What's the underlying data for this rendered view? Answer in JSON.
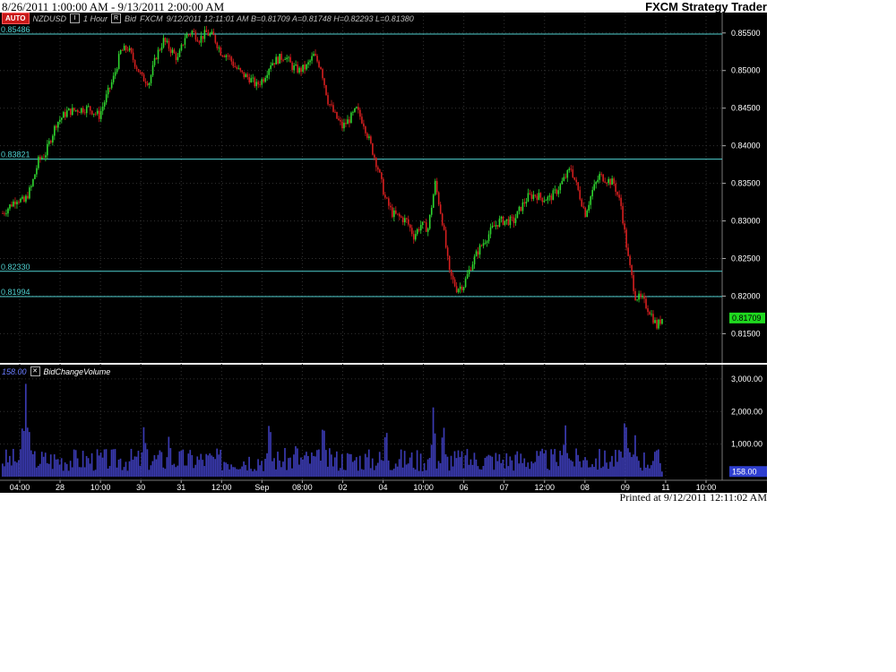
{
  "header": {
    "range": "8/26/2011 1:00:00 AM - 9/13/2011 2:00:00 AM",
    "app": "FXCM Strategy Trader"
  },
  "footer": {
    "printed": "Printed at 9/12/2011 12:11:02 AM"
  },
  "toolbar": {
    "auto_label": "AUTO",
    "symbol": "NZDUSD",
    "timeframe": "1 Hour",
    "price_type": "Bid",
    "broker": "FXCM",
    "quote": "9/12/2011  12:11:01 AM  B=0.81709  A=0.81748  H=0.82293  L=0.81380"
  },
  "volume_panel": {
    "current_label": "158.00",
    "indicator_name": "BidChangeVolume"
  },
  "colors": {
    "background": "#000000",
    "bull": "#2fd62f",
    "bear": "#d61f1f",
    "level_lines": "#4fd0d0",
    "volume_bars": "#3a3ab0",
    "price_tag": "#1fd81f",
    "volume_tag": "#2f3fd0"
  },
  "chart_data": [
    {
      "type": "candlestick",
      "series": [
        {
          "name": "NZDUSD"
        }
      ],
      "ylim": [
        0.811,
        0.857
      ],
      "y_ticks": [
        0.855,
        0.85,
        0.845,
        0.84,
        0.835,
        0.83,
        0.825,
        0.82,
        0.815
      ],
      "y_tick_labels": [
        "0.85500",
        "0.85000",
        "0.84500",
        "0.84000",
        "0.83500",
        "0.83000",
        "0.82500",
        "0.82000",
        "0.81500"
      ],
      "x_tick_labels": [
        "04:00",
        "28",
        "10:00",
        "30",
        "31",
        "12:00",
        "Sep",
        "08:00",
        "02",
        "04",
        "10:00",
        "06",
        "07",
        "12:00",
        "08",
        "09",
        "11",
        "10:00"
      ],
      "last_price_label": "0.81709",
      "last_price": 0.81709,
      "horizontal_levels": [
        {
          "label": "0.85486",
          "value": 0.85486
        },
        {
          "label": "0.83821",
          "value": 0.83821
        },
        {
          "label": "0.82330",
          "value": 0.8233
        },
        {
          "label": "0.81994",
          "value": 0.81994
        }
      ],
      "close_path": [
        [
          0,
          0.831
        ],
        [
          4,
          0.832
        ],
        [
          8,
          0.833
        ],
        [
          12,
          0.8325
        ],
        [
          16,
          0.8345
        ],
        [
          20,
          0.838
        ],
        [
          24,
          0.839
        ],
        [
          30,
          0.843
        ],
        [
          36,
          0.8445
        ],
        [
          42,
          0.8448
        ],
        [
          48,
          0.845
        ],
        [
          54,
          0.844
        ],
        [
          58,
          0.8465
        ],
        [
          62,
          0.849
        ],
        [
          66,
          0.8525
        ],
        [
          70,
          0.853
        ],
        [
          74,
          0.851
        ],
        [
          78,
          0.849
        ],
        [
          82,
          0.8485
        ],
        [
          86,
          0.852
        ],
        [
          90,
          0.854
        ],
        [
          94,
          0.8528
        ],
        [
          98,
          0.8515
        ],
        [
          102,
          0.8545
        ],
        [
          106,
          0.8552
        ],
        [
          110,
          0.8542
        ],
        [
          114,
          0.855
        ],
        [
          118,
          0.8545
        ],
        [
          122,
          0.8525
        ],
        [
          126,
          0.852
        ],
        [
          130,
          0.8505
        ],
        [
          134,
          0.8495
        ],
        [
          138,
          0.849
        ],
        [
          142,
          0.848
        ],
        [
          146,
          0.849
        ],
        [
          150,
          0.851
        ],
        [
          154,
          0.8515
        ],
        [
          158,
          0.852
        ],
        [
          162,
          0.8505
        ],
        [
          166,
          0.85
        ],
        [
          170,
          0.8505
        ],
        [
          174,
          0.852
        ],
        [
          178,
          0.8505
        ],
        [
          182,
          0.846
        ],
        [
          186,
          0.844
        ],
        [
          190,
          0.8425
        ],
        [
          194,
          0.8435
        ],
        [
          198,
          0.8448
        ],
        [
          202,
          0.843
        ],
        [
          206,
          0.84
        ],
        [
          210,
          0.837
        ],
        [
          214,
          0.833
        ],
        [
          218,
          0.831
        ],
        [
          222,
          0.8305
        ],
        [
          226,
          0.83
        ],
        [
          230,
          0.828
        ],
        [
          234,
          0.8295
        ],
        [
          238,
          0.829
        ],
        [
          242,
          0.835
        ],
        [
          246,
          0.83
        ],
        [
          250,
          0.823
        ],
        [
          254,
          0.821
        ],
        [
          258,
          0.8215
        ],
        [
          262,
          0.824
        ],
        [
          266,
          0.826
        ],
        [
          270,
          0.8275
        ],
        [
          274,
          0.829
        ],
        [
          278,
          0.83
        ],
        [
          282,
          0.83
        ],
        [
          286,
          0.83
        ],
        [
          290,
          0.8318
        ],
        [
          294,
          0.8332
        ],
        [
          298,
          0.8335
        ],
        [
          302,
          0.833
        ],
        [
          306,
          0.833
        ],
        [
          310,
          0.834
        ],
        [
          314,
          0.8355
        ],
        [
          318,
          0.837
        ],
        [
          322,
          0.834
        ],
        [
          326,
          0.831
        ],
        [
          330,
          0.834
        ],
        [
          334,
          0.836
        ],
        [
          338,
          0.8355
        ],
        [
          342,
          0.835
        ],
        [
          346,
          0.832
        ],
        [
          350,
          0.825
        ],
        [
          354,
          0.82
        ],
        [
          358,
          0.8195
        ],
        [
          362,
          0.818
        ],
        [
          366,
          0.816
        ],
        [
          369,
          0.8171
        ]
      ],
      "n_candles": 370
    },
    {
      "type": "bar",
      "series": [
        {
          "name": "BidChangeVolume"
        }
      ],
      "ylim": [
        0,
        3300
      ],
      "y_ticks": [
        1000,
        2000,
        3000
      ],
      "y_tick_labels": [
        "1,000.00",
        "2,000.00",
        "3,000.00"
      ],
      "last_value": 158.0,
      "peaks": [
        [
          28,
          2900
        ],
        [
          24,
          1500
        ],
        [
          32,
          1400
        ],
        [
          160,
          1700
        ],
        [
          188,
          1400
        ],
        [
          300,
          1950
        ],
        [
          330,
          1200
        ],
        [
          360,
          1900
        ],
        [
          430,
          1700
        ],
        [
          483,
          2300
        ],
        [
          494,
          1800
        ],
        [
          630,
          1700
        ],
        [
          697,
          2100
        ],
        [
          708,
          1300
        ]
      ],
      "base": 550
    }
  ]
}
